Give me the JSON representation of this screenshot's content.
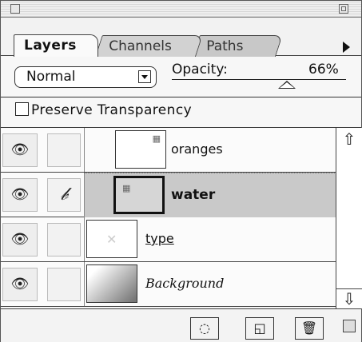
{
  "tabs": [
    {
      "label": "Layers",
      "active": true
    },
    {
      "label": "Channels",
      "active": false
    },
    {
      "label": "Paths",
      "active": false
    }
  ],
  "blend_mode": "Normal",
  "opacity": {
    "label": "Opacity:",
    "value": "66%",
    "level": 0.66
  },
  "preserve_transparency": {
    "label": "Preserve Transparency",
    "checked": false
  },
  "layers": [
    {
      "name": "oranges",
      "visible": true,
      "brush": false,
      "selected": false,
      "style": "normal"
    },
    {
      "name": "water",
      "visible": true,
      "brush": true,
      "selected": true,
      "style": "bold"
    },
    {
      "name": "type",
      "visible": true,
      "brush": false,
      "selected": false,
      "style": "underline"
    },
    {
      "name": "Background",
      "visible": true,
      "brush": false,
      "selected": false,
      "style": "italic"
    }
  ],
  "icons": {
    "eye": "eye-icon",
    "brush": "paintbrush-icon",
    "scroll_up": "arrow-up-icon",
    "scroll_down": "arrow-down-icon",
    "mask": "layer-mask-icon",
    "new_layer": "new-layer-icon",
    "trash": "trash-icon",
    "palette_menu": "triangle-right-icon"
  }
}
